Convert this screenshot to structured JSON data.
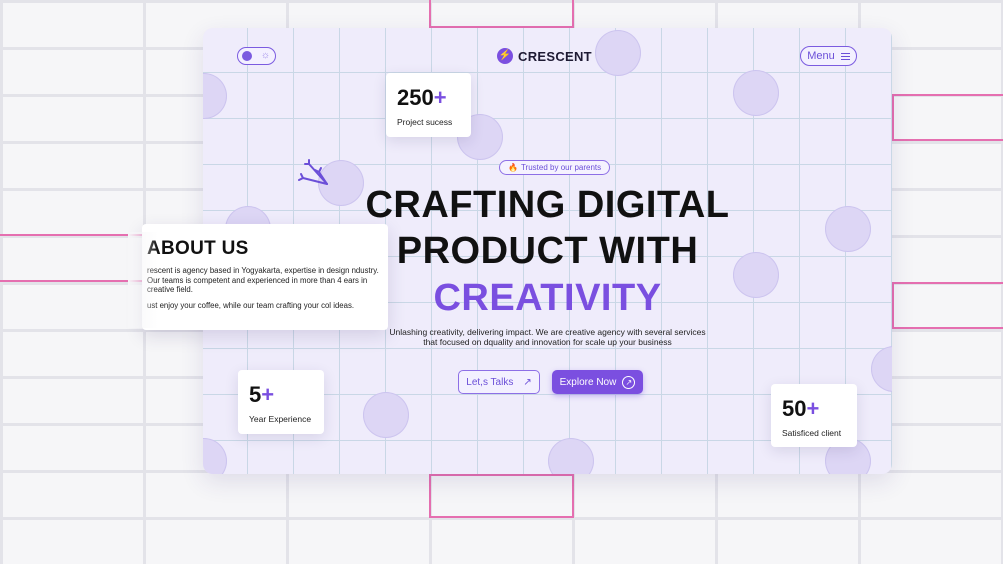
{
  "brand": {
    "name": "CRESCENT",
    "mark_icon": "bolt-icon",
    "accent": "#7a4fe0"
  },
  "header": {
    "menu_label": "Menu",
    "theme_icon": "sun-icon"
  },
  "badge": {
    "text": "Trusted by our parents",
    "icon": "fire-icon"
  },
  "hero": {
    "line1": "CRAFTING DIGITAL",
    "line2": "PRODUCT WITH",
    "line3": "CREATIVITY",
    "sub1": "Unlashing creativity, delivering impact. We are creative agency with several services",
    "sub2": "that focused on dquality and innovation for scale up your business"
  },
  "actions": {
    "talk_label": "Let,s Talks",
    "explore_label": "Explore Now"
  },
  "stats": [
    {
      "value": "250",
      "suffix": "+",
      "label": "Project sucess"
    },
    {
      "value": "5",
      "suffix": "+",
      "label": "Year Experience"
    },
    {
      "value": "50",
      "suffix": "+",
      "label": "Satisficed client"
    }
  ],
  "about": {
    "title": "ABOUT US",
    "body": "rescent is agency based in Yogyakarta, expertise in design ndustry. Our teams is competent and experienced in more than 4 ears in creative field.",
    "body2": "ust enjoy your coffee, while our team crafting your col ideas."
  }
}
